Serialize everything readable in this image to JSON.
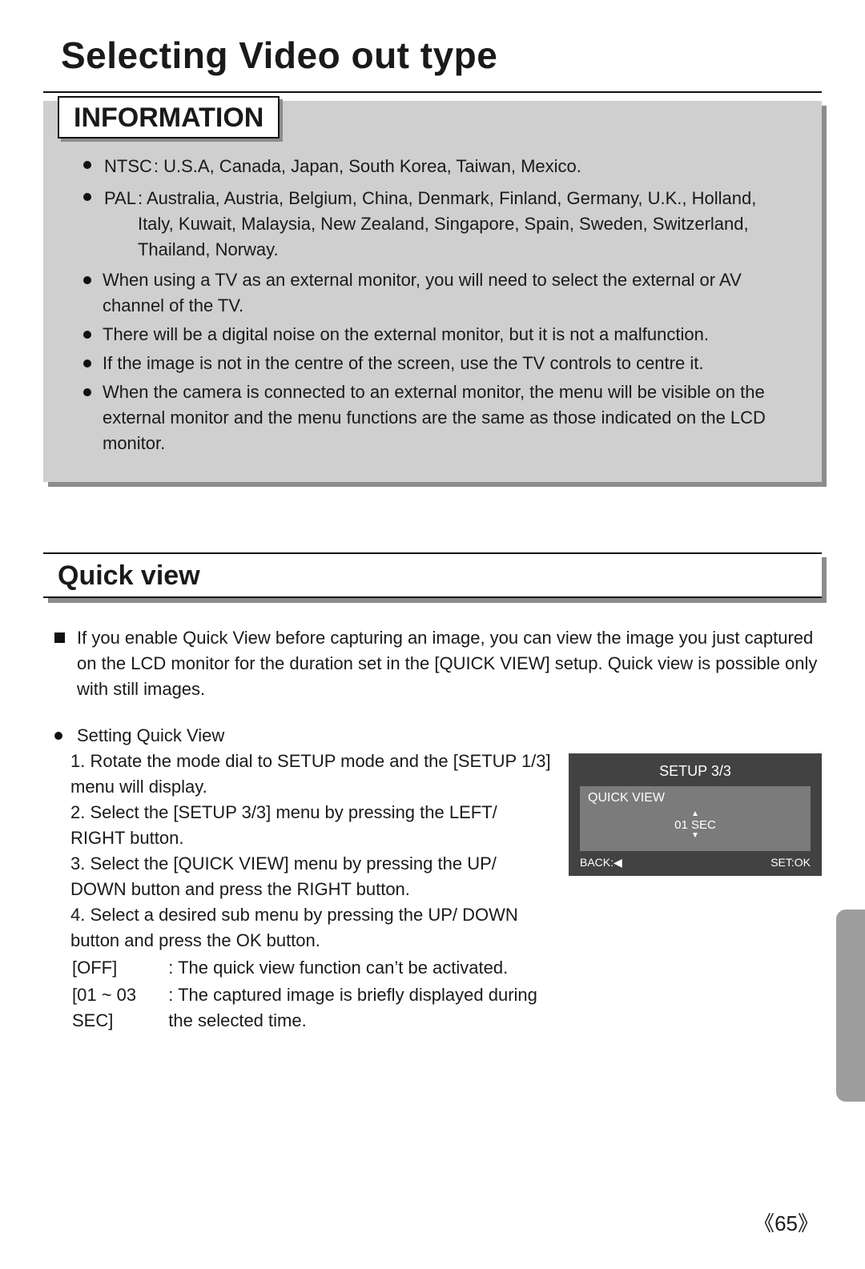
{
  "title": "Selecting Video out type",
  "info": {
    "header": "INFORMATION",
    "ntsc_label": "NTSC",
    "ntsc_text": ": U.S.A, Canada, Japan, South Korea, Taiwan, Mexico.",
    "pal_label": "PAL",
    "pal_text": ": Australia, Austria, Belgium, China, Denmark, Finland, Germany, U.K., Holland, Italy, Kuwait, Malaysia, New Zealand, Singapore, Spain, Sweden, Switzerland, Thailand, Norway.",
    "b3": "When using a TV as an external monitor, you will need to select the external or AV channel of the TV.",
    "b4": "There will be a digital noise on the external monitor, but it is not a malfunction.",
    "b5": "If the image is not in the centre of the screen, use the TV controls to centre it.",
    "b6": "When the camera is connected to an external monitor, the menu will be visible on the external monitor and the menu functions are the same as those indicated on the LCD monitor."
  },
  "quick": {
    "header": "Quick view",
    "intro": "If you enable Quick View before capturing an image, you can view the image you just captured on the LCD monitor for the duration set in the [QUICK VIEW] setup. Quick view is possible only with still images.",
    "setting_title": "Setting Quick View",
    "s1": "1. Rotate the mode dial to SETUP mode and the [SETUP 1/3] menu will display.",
    "s2": "2. Select the [SETUP 3/3] menu by pressing the LEFT/ RIGHT button.",
    "s3": "3. Select the [QUICK VIEW] menu by pressing the UP/ DOWN button and press the RIGHT button.",
    "s4": "4. Select a desired sub menu by pressing the UP/ DOWN button and press the OK button.",
    "off_label": "[OFF]",
    "off_text": ": The quick view function can’t be activated.",
    "sec_label": "[01 ~ 03 SEC]",
    "sec_text": ": The captured image is briefly displayed during the selected time."
  },
  "lcd": {
    "title": "SETUP 3/3",
    "item": "QUICK VIEW",
    "value": "01  SEC",
    "back": "BACK:◀",
    "set": "SET:OK"
  },
  "page_number": "65"
}
